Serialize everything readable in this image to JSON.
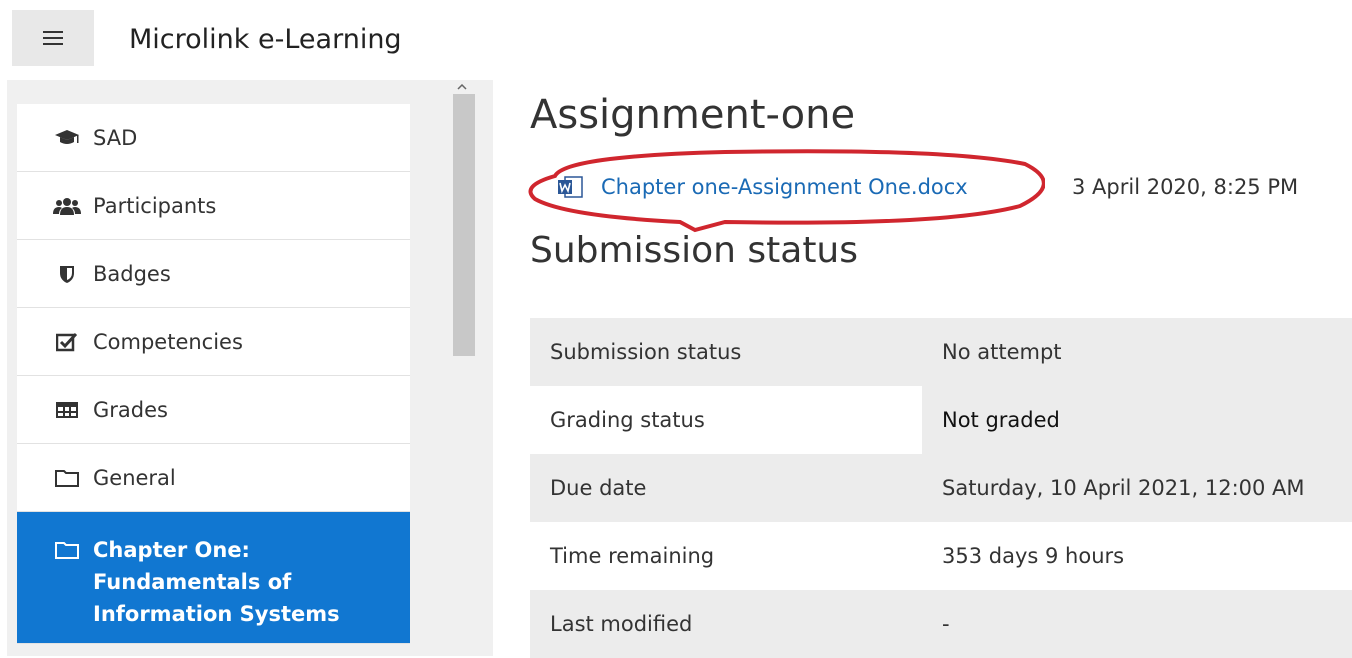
{
  "app": {
    "title": "Microlink e-Learning"
  },
  "sidebar": {
    "items": [
      {
        "label": "SAD",
        "icon": "graduation-cap-icon"
      },
      {
        "label": "Participants",
        "icon": "users-icon"
      },
      {
        "label": "Badges",
        "icon": "shield-icon"
      },
      {
        "label": "Competencies",
        "icon": "checkbox-icon"
      },
      {
        "label": "Grades",
        "icon": "table-icon"
      },
      {
        "label": "General",
        "icon": "folder-icon"
      },
      {
        "label": "Chapter One: Fundamentals of Information Systems",
        "icon": "folder-icon",
        "active": true
      }
    ]
  },
  "main": {
    "title": "Assignment-one",
    "file": {
      "name": "Chapter one-Assignment One.docx",
      "date": "3 April 2020, 8:25 PM",
      "icon": "word-document-icon"
    },
    "section_title": "Submission status",
    "status_rows": [
      {
        "label": "Submission status",
        "value": "No attempt"
      },
      {
        "label": "Grading status",
        "value": "Not graded"
      },
      {
        "label": "Due date",
        "value": "Saturday, 10 April 2021, 12:00 AM"
      },
      {
        "label": "Time remaining",
        "value": "353 days 9 hours"
      },
      {
        "label": "Last modified",
        "value": "-"
      }
    ]
  },
  "colors": {
    "accent": "#1177d1",
    "highlight_circle": "#d0262e",
    "link": "#1a6ab5"
  }
}
